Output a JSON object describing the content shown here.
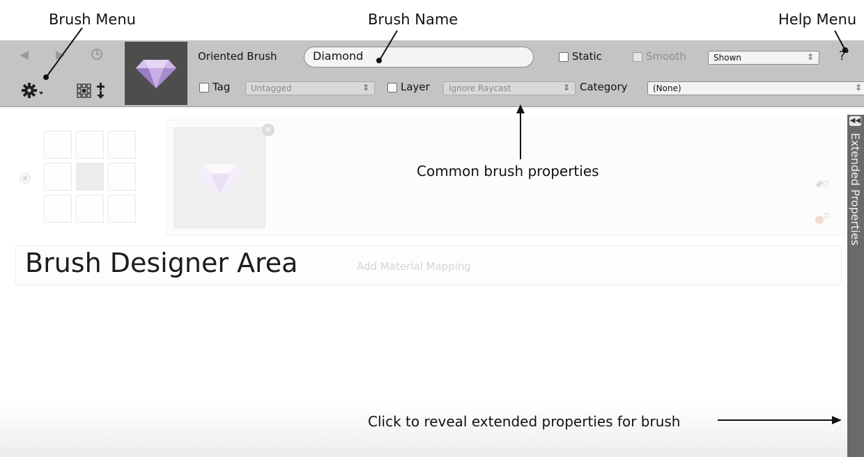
{
  "annotations": {
    "brush_menu": "Brush Menu",
    "brush_name": "Brush Name",
    "help_menu": "Help Menu",
    "common_props": "Common brush properties",
    "designer_area": "Brush Designer Area",
    "click_reveal": "Click to reveal extended properties for brush"
  },
  "toolbar": {
    "nav_icons": [
      "back-arrow-icon",
      "forward-arrow-icon",
      "history-icon"
    ],
    "brush_type": "Oriented Brush",
    "brush_name_value": "Diamond",
    "static_label": "Static",
    "smooth_label": "Smooth",
    "visibility_value": "Shown",
    "help_label": "?",
    "tag_label": "Tag",
    "tag_value": "Untagged",
    "layer_label": "Layer",
    "layer_value": "Ignore Raycast",
    "category_label": "Category",
    "category_value": "(None)",
    "select_arrow": "⇕"
  },
  "designer": {
    "add_material_mapping": "Add Material Mapping",
    "remove_icon": "×"
  },
  "side_panel": {
    "label": "Extended Properties",
    "toggle_glyph": "◀◀"
  },
  "colors": {
    "toolbar_bg": "#c4c4c4",
    "preview_bg": "#4d4d4d",
    "side_panel_bg": "#6a6a6a",
    "gem": "#b89ad6"
  }
}
